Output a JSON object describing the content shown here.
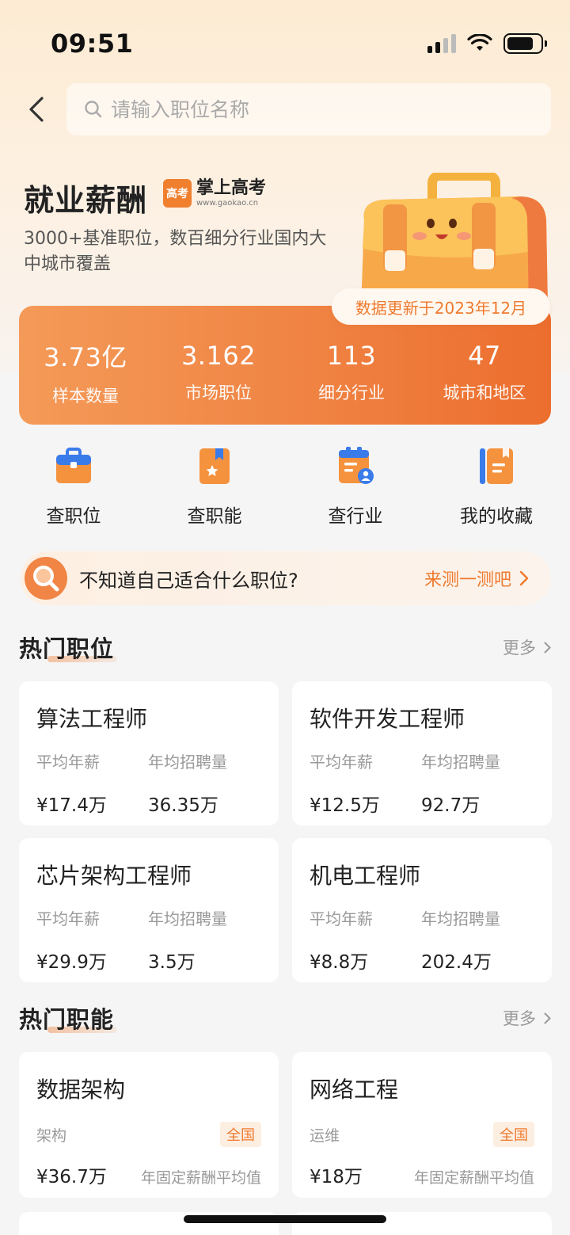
{
  "status_bar": {
    "time": "09:51"
  },
  "search": {
    "placeholder": "请输入职位名称"
  },
  "hero": {
    "title": "就业薪酬",
    "brand_name": "掌上高考",
    "brand_url": "www.gaokao.cn",
    "brand_logo_text": "高考",
    "subtitle": "3000+基准职位，数百细分行业国内大中城市覆盖",
    "update_note": "数据更新于2023年12月"
  },
  "stats": [
    {
      "value": "3.73亿",
      "label": "样本数量"
    },
    {
      "value": "3.162",
      "label": "市场职位"
    },
    {
      "value": "113",
      "label": "细分行业"
    },
    {
      "value": "47",
      "label": "城市和地区"
    }
  ],
  "quick_nav": [
    {
      "label": "查职位",
      "icon": "briefcase-icon"
    },
    {
      "label": "查职能",
      "icon": "bookmark-star-icon"
    },
    {
      "label": "查行业",
      "icon": "clipboard-person-icon"
    },
    {
      "label": "我的收藏",
      "icon": "notebook-icon"
    }
  ],
  "quiz": {
    "text": "不知道自己适合什么职位?",
    "link": "来测一测吧"
  },
  "hot_jobs": {
    "title": "热门职位",
    "more": "更多",
    "salary_label": "平均年薪",
    "hiring_label": "年均招聘量",
    "items": [
      {
        "name": "算法工程师",
        "salary": "¥17.4万",
        "hiring": "36.35万"
      },
      {
        "name": "软件开发工程师",
        "salary": "¥12.5万",
        "hiring": "92.7万"
      },
      {
        "name": "芯片架构工程师",
        "salary": "¥29.9万",
        "hiring": "3.5万"
      },
      {
        "name": "机电工程师",
        "salary": "¥8.8万",
        "hiring": "202.4万"
      }
    ]
  },
  "hot_functions": {
    "title": "热门职能",
    "more": "更多",
    "items": [
      {
        "name": "数据架构",
        "tag": "架构",
        "region": "全国",
        "salary": "¥36.7万",
        "note": "年固定薪酬平均值"
      },
      {
        "name": "网络工程",
        "tag": "运维",
        "region": "全国",
        "salary": "¥18万",
        "note": "年固定薪酬平均值"
      }
    ]
  },
  "colors": {
    "accent": "#ef7a2e",
    "stats_gradient_start": "#f49a58",
    "stats_gradient_end": "#ec6e2e"
  }
}
